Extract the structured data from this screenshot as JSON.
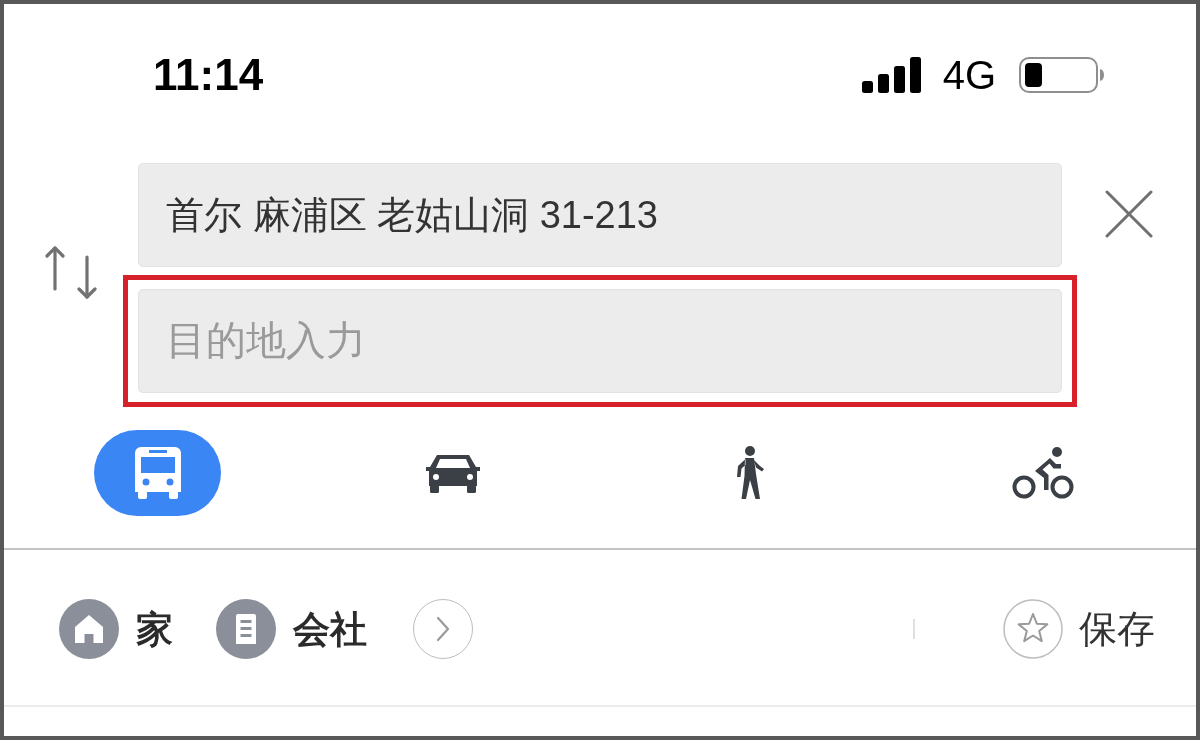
{
  "status_bar": {
    "time": "11:14",
    "network": "4G"
  },
  "route": {
    "origin": {
      "value": "首尔 麻浦区 老姑山洞 31-213"
    },
    "destination": {
      "placeholder": "目的地入力",
      "highlighted": true
    }
  },
  "modes": [
    {
      "kind": "transit",
      "selected": true
    },
    {
      "kind": "car",
      "selected": false
    },
    {
      "kind": "walk",
      "selected": false
    },
    {
      "kind": "bicycle",
      "selected": false
    }
  ],
  "shortcuts": [
    {
      "kind": "home",
      "label": "家"
    },
    {
      "kind": "work",
      "label": "会社"
    }
  ],
  "save": {
    "label": "保存"
  }
}
